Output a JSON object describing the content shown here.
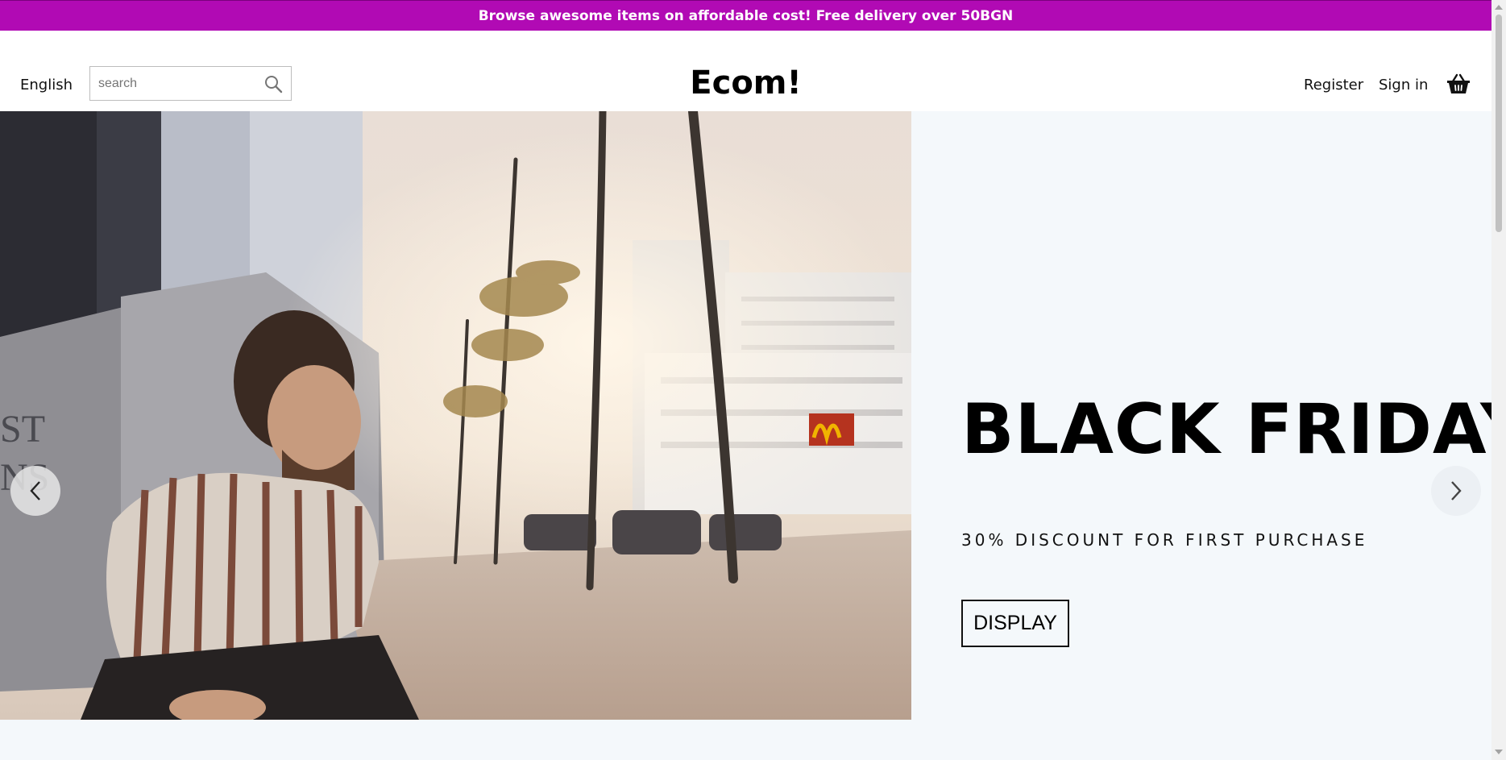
{
  "announcement": {
    "text": "Browse awesome items on affordable cost! Free delivery over 50BGN",
    "background": "#b10ab4"
  },
  "header": {
    "language": "English",
    "search": {
      "placeholder": "search",
      "value": "",
      "icon": "search-icon"
    },
    "logo": "Ecom!",
    "nav": {
      "register": "Register",
      "sign_in": "Sign in"
    },
    "cart_icon": "basket-icon"
  },
  "hero": {
    "title": "BLACK FRIDAY",
    "subtitle": "30% DISCOUNT FOR FIRST PURCHASE",
    "button": "DISPLAY",
    "background": "#f4f8fb",
    "prev_icon": "chevron-left-icon",
    "next_icon": "chevron-right-icon"
  }
}
